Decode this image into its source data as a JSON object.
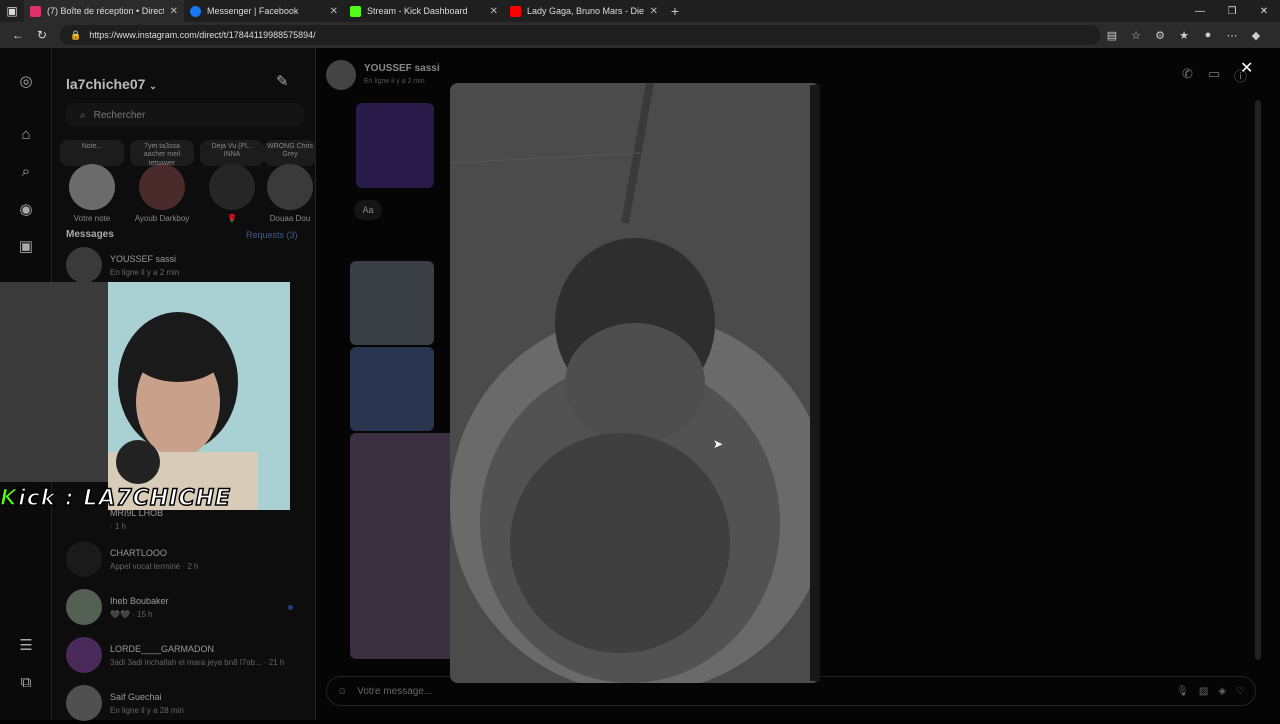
{
  "browser": {
    "tabs": [
      {
        "title": "(7) Boîte de réception • Direct",
        "color": "#e1306c"
      },
      {
        "title": "Messenger | Facebook",
        "color": "#1877f2"
      },
      {
        "title": "Stream - Kick Dashboard",
        "color": "#53fc18"
      },
      {
        "title": "Lady Gaga, Bruno Mars - Die With",
        "color": "#ff0000"
      }
    ],
    "url": "https://www.instagram.com/direct/t/17844119988575894/"
  },
  "sidebar": {
    "username": "la7chiche07",
    "search_placeholder": "Rechercher",
    "notes": [
      {
        "text": "Note...",
        "name": "Votre note"
      },
      {
        "text": "7yet ta3ssa aacher meil tetsawer",
        "name": "Ayoub Darkboy"
      },
      {
        "text": "Deja Vu (Pl... INNA",
        "name": "🌹"
      },
      {
        "text": "WRONG Chris Grey",
        "name": "Douaa Dou"
      }
    ],
    "messages_label": "Messages",
    "requests_label": "Requests (3)",
    "conversations": [
      {
        "name": "YOUSSEF sassi",
        "preview": "En ligne il y a 2 min"
      },
      {
        "name": "MRI9L LHOB",
        "preview": "· 1 h"
      },
      {
        "name": "CHARTLOOO",
        "preview": "Appel vocal terminé · 2 h"
      },
      {
        "name": "Iheb Boubaker",
        "preview": "🖤🖤 · 15 h"
      },
      {
        "name": "LORDE____GARMADON",
        "preview": "3adi 3adi inchallah el mara jeya bn8 l7ob... · 21 h"
      },
      {
        "name": "Saif Guechai",
        "preview": "En ligne il y a 28 min"
      }
    ]
  },
  "chat": {
    "contact_name": "YOUSSEF sassi",
    "contact_status": "En ligne il y a 2 min",
    "aa_label": "Aa",
    "composer_placeholder": "Votre message..."
  },
  "stream_overlay": {
    "kick_prefix": "K",
    "kick_text": "ick : LA7CHICHE"
  }
}
